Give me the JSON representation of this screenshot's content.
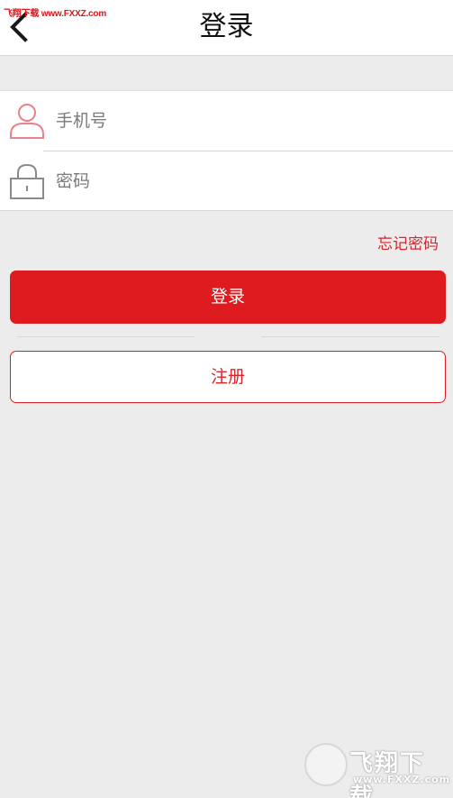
{
  "watermark": {
    "top_text": "飞翔下载 www.FXXZ.com",
    "bottom_big": "飞翔下载",
    "bottom_small": "www.FXXZ.com"
  },
  "header": {
    "title": "登录",
    "back_icon": "chevron-left-icon"
  },
  "form": {
    "phone": {
      "placeholder": "手机号",
      "value": "",
      "icon": "user-icon"
    },
    "password": {
      "placeholder": "密码",
      "value": "",
      "icon": "lock-icon"
    }
  },
  "links": {
    "forgot_password": "忘记密码"
  },
  "buttons": {
    "login": "登录",
    "register": "注册"
  },
  "colors": {
    "accent": "#de1b1e",
    "background": "#ececec",
    "user_icon": "#e8838a",
    "lock_icon": "#8a8a8a"
  }
}
